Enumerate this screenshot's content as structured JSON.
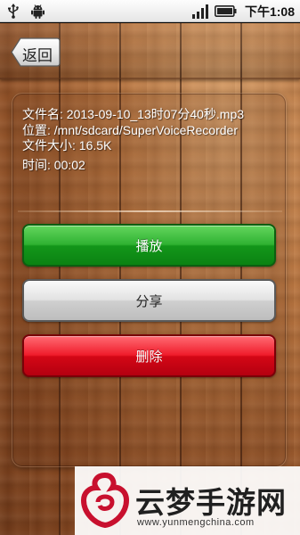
{
  "status_bar": {
    "time": "下午1:08",
    "icons": [
      "usb-icon",
      "android-icon",
      "signal-icon",
      "battery-icon"
    ]
  },
  "header": {
    "back_label": "返回"
  },
  "file_info": {
    "filename": "文件名: 2013-09-10_13时07分40秒.mp3",
    "location": "位置: /mnt/sdcard/SuperVoiceRecorder",
    "size": "文件大小: 16.5K",
    "duration": "时间: 00:02"
  },
  "actions": {
    "play_label": "播放",
    "share_label": "分享",
    "delete_label": "删除"
  },
  "watermark": {
    "title": "云梦手游网",
    "url": "www.yunmengchina.com"
  },
  "colors": {
    "play": "#1fa526",
    "share": "#d6d6d6",
    "delete": "#e3101e",
    "wood": "#b8743f"
  }
}
